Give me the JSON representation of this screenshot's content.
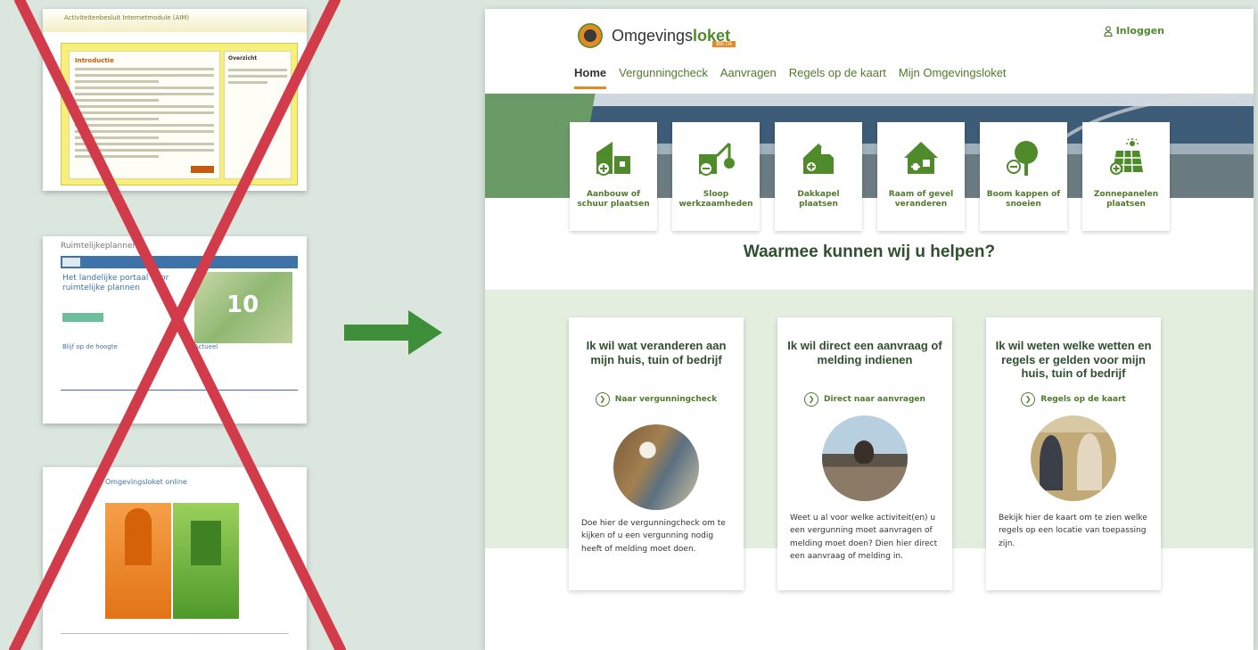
{
  "old_sites": {
    "site1": {
      "header": "Activiteitenbesluit Internetmodule (AIM)",
      "title": "Introductie",
      "side_title": "Overzicht"
    },
    "site2": {
      "header": "Ruimtelijkeplannen",
      "links": "Home  FAQ  Contact",
      "title": "Het landelijke portaal voor ruimtelijke plannen",
      "map_number": "10",
      "section_left": "Blijf op de hoogte",
      "section_right": "Actueel"
    },
    "site3": {
      "header": "Omgevingsloket online"
    }
  },
  "new_site": {
    "logo": {
      "text_main": "Omgevings",
      "text_accent": "loket",
      "beta": "BETA"
    },
    "login_label": "Inloggen",
    "nav": [
      "Home",
      "Vergunningcheck",
      "Aanvragen",
      "Regels op de kaart",
      "Mijn Omgevingsloket"
    ],
    "tasks": [
      {
        "label": "Aanbouw of schuur plaatsen"
      },
      {
        "label": "Sloop werkzaamheden"
      },
      {
        "label": "Dakkapel plaatsen"
      },
      {
        "label": "Raam of gevel veranderen"
      },
      {
        "label": "Boom kappen of snoeien"
      },
      {
        "label": "Zonnepanelen plaatsen"
      }
    ],
    "help_heading": "Waarmee kunnen wij u helpen?",
    "cards": [
      {
        "title": "Ik wil wat veranderen aan mijn huis, tuin of bedrijf",
        "link": "Naar vergunningcheck",
        "description": "Doe hier de vergunningcheck om te kijken of u een vergunning nodig heeft of melding moet doen."
      },
      {
        "title": "Ik wil direct een aanvraag of melding indienen",
        "link": "Direct naar aanvragen",
        "description": "Weet u al voor welke activiteit(en) u een vergunning moet aanvragen of melding moet doen? Dien hier direct een aanvraag of melding in."
      },
      {
        "title": "Ik wil weten welke wetten en regels er gelden voor mijn huis, tuin of bedrijf",
        "link": "Regels op de kaart",
        "description": "Bekijk hier de kaart om te zien welke regels op een locatie van toepassing zijn."
      }
    ],
    "colors": {
      "brand_green": "#4f7a2b",
      "accent_orange": "#e38a24",
      "band_green": "#e4eedf"
    }
  },
  "colors": {
    "cross_red": "#d23c4a",
    "arrow_green": "#3f8f3a",
    "background": "#dbe6df"
  }
}
